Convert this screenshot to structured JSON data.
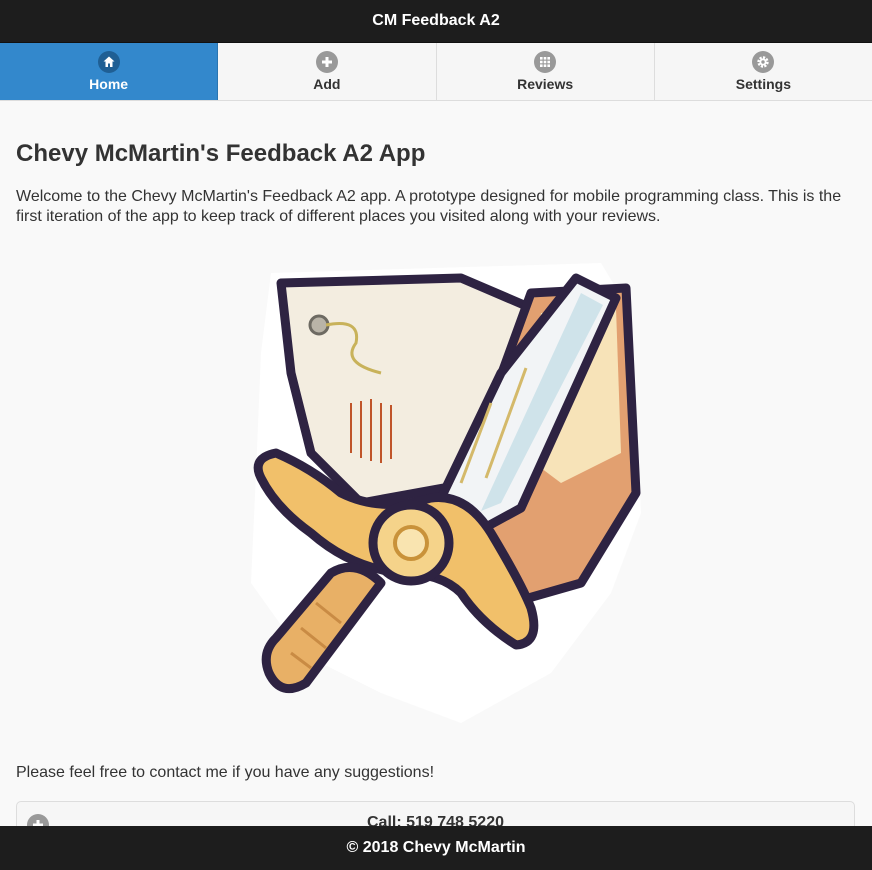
{
  "header": {
    "title": "CM Feedback A2"
  },
  "nav": {
    "tabs": [
      {
        "label": "Home",
        "icon": "home-icon",
        "active": true
      },
      {
        "label": "Add",
        "icon": "plus-icon",
        "active": false
      },
      {
        "label": "Reviews",
        "icon": "grid-icon",
        "active": false
      },
      {
        "label": "Settings",
        "icon": "gear-icon",
        "active": false
      }
    ]
  },
  "main": {
    "title": "Chevy McMartin's Feedback A2 App",
    "intro": "Welcome to the Chevy McMartin's Feedback A2 app. A prototype designed for mobile programming class. This is the first iteration of the app to keep track of different places you visited along with your reviews.",
    "hero_image": "sword-and-shield-illustration",
    "contact_text": "Please feel free to contact me if you have any suggestions!",
    "call_button": "Call: 519 748 5220"
  },
  "footer": {
    "text": "© 2018 Chevy McMartin"
  },
  "colors": {
    "header": "#1d1d1d",
    "active_tab": "#3388cc",
    "background": "#f9f9f9"
  }
}
